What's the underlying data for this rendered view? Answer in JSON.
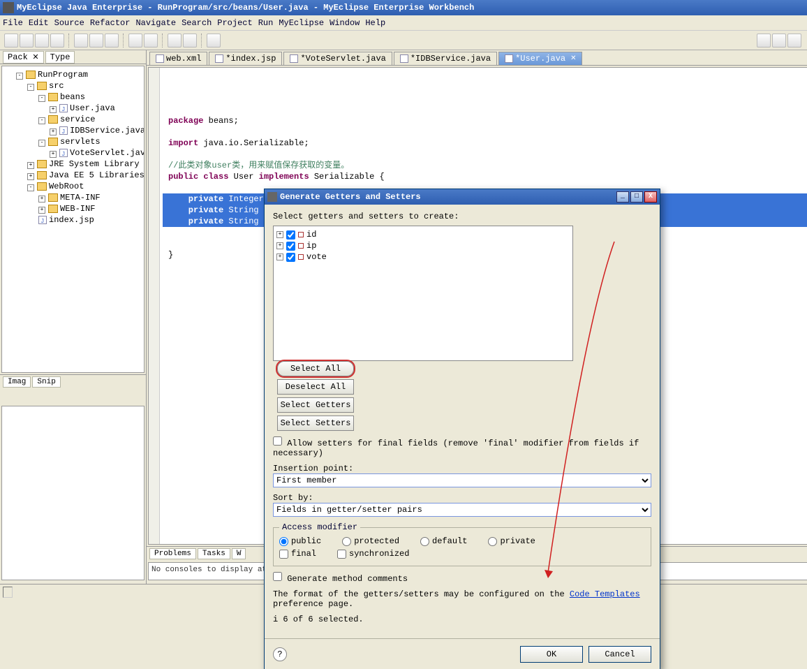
{
  "title": "MyEclipse Java Enterprise - RunProgram/src/beans/User.java - MyEclipse Enterprise Workbench",
  "menu": [
    "File",
    "Edit",
    "Source",
    "Refactor",
    "Navigate",
    "Search",
    "Project",
    "Run",
    "MyEclipse",
    "Window",
    "Help"
  ],
  "left_views": {
    "pack": "Pack",
    "type": "Type"
  },
  "tree": {
    "project": "RunProgram",
    "src": "src",
    "beans": "beans",
    "user_java": "User.java",
    "service": "service",
    "idbservice": "IDBService.java",
    "servlets": "servlets",
    "voteservlet": "VoteServlet.java",
    "jre": "JRE System Library [Su",
    "javaee": "Java EE 5 Libraries",
    "webroot": "WebRoot",
    "metainf": "META-INF",
    "webinf": "WEB-INF",
    "indexjsp": "index.jsp"
  },
  "mini_views": {
    "imag": "Imag",
    "snip": "Snip"
  },
  "editor_tabs": {
    "web": "web.xml",
    "index": "*index.jsp",
    "vote": "*VoteServlet.java",
    "idb": "*IDBService.java",
    "user": "*User.java"
  },
  "code": {
    "l1": "package beans;",
    "l2": "",
    "l3": "import java.io.Serializable;",
    "l4": "",
    "l5": "//此类对象user类，用来赋值保存获取的变量。",
    "l6a": "public class ",
    "l6b": "User",
    "l6c": " implements ",
    "l6d": "Serializable {",
    "l7": "",
    "h1": "    private Integer id;//这里不要定义成int类型，不然无法进行判空操作。",
    "h2": "    private String ip;",
    "h3": "    private String vote;",
    "l8": "",
    "l9": "}"
  },
  "bottom_tabs": {
    "problems": "Problems",
    "tasks": "Tasks",
    "w": "W"
  },
  "console_msg": "No consoles to display at t",
  "dialog": {
    "title": "Generate Getters and Setters",
    "prompt": "Select getters and setters to create:",
    "fields": {
      "id": "id",
      "ip": "ip",
      "vote": "vote"
    },
    "btn_select_all": "Select All",
    "btn_deselect_all": "Deselect All",
    "btn_select_getters": "Select Getters",
    "btn_select_setters": "Select Setters",
    "allow_final": "Allow setters for final fields (remove 'final' modifier from fields if necessary)",
    "insertion_label": "Insertion point:",
    "insertion_value": "First member",
    "sort_label": "Sort by:",
    "sort_value": "Fields in getter/setter pairs",
    "access_legend": "Access modifier",
    "mod_public": "public",
    "mod_protected": "protected",
    "mod_default": "default",
    "mod_private": "private",
    "mod_final": "final",
    "mod_sync": "synchronized",
    "gen_comments": "Generate method comments",
    "hint_pre": "The format of the getters/setters may be configured on the ",
    "hint_link": "Code Templates",
    "hint_post": " preference page.",
    "info_prefix": "i  ",
    "info": "6 of 6 selected.",
    "ok": "OK",
    "cancel": "Cancel"
  }
}
